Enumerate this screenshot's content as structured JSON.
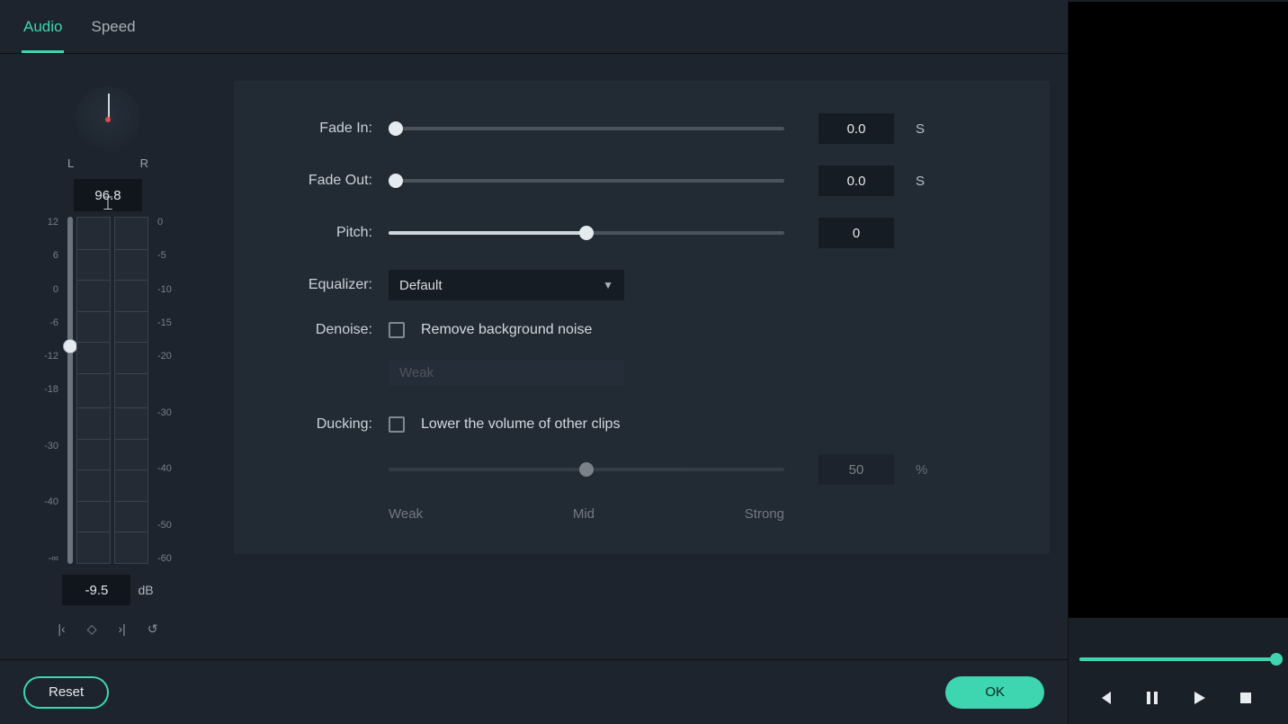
{
  "tabs": {
    "audio": "Audio",
    "speed": "Speed"
  },
  "pan": {
    "L": "L",
    "R": "R",
    "value": "96.8"
  },
  "meter": {
    "left_ticks": [
      "12",
      "6",
      "0",
      "-6",
      "-12",
      "-18",
      "",
      "-30",
      "",
      "-40",
      "",
      "-∞"
    ],
    "right_ticks": [
      "0",
      "-5",
      "-10",
      "-15",
      "-20",
      "",
      "-30",
      "",
      "-40",
      "",
      "-50",
      "-60"
    ],
    "db_value": "-9.5",
    "db_unit": "dB"
  },
  "keyframes": {
    "prev": "K",
    "add": "◇",
    "next": "›|",
    "reset": "↺"
  },
  "settings": {
    "fade_in": {
      "label": "Fade In:",
      "value": "0.0",
      "unit": "S"
    },
    "fade_out": {
      "label": "Fade Out:",
      "value": "0.0",
      "unit": "S"
    },
    "pitch": {
      "label": "Pitch:",
      "value": "0"
    },
    "equalizer": {
      "label": "Equalizer:",
      "value": "Default"
    },
    "denoise": {
      "label": "Denoise:",
      "chk_label": "Remove background noise",
      "level": "Weak"
    },
    "ducking": {
      "label": "Ducking:",
      "chk_label": "Lower the volume of other clips",
      "value": "50",
      "unit": "%",
      "marks": {
        "weak": "Weak",
        "mid": "Mid",
        "strong": "Strong"
      }
    }
  },
  "footer": {
    "reset": "Reset",
    "ok": "OK"
  }
}
